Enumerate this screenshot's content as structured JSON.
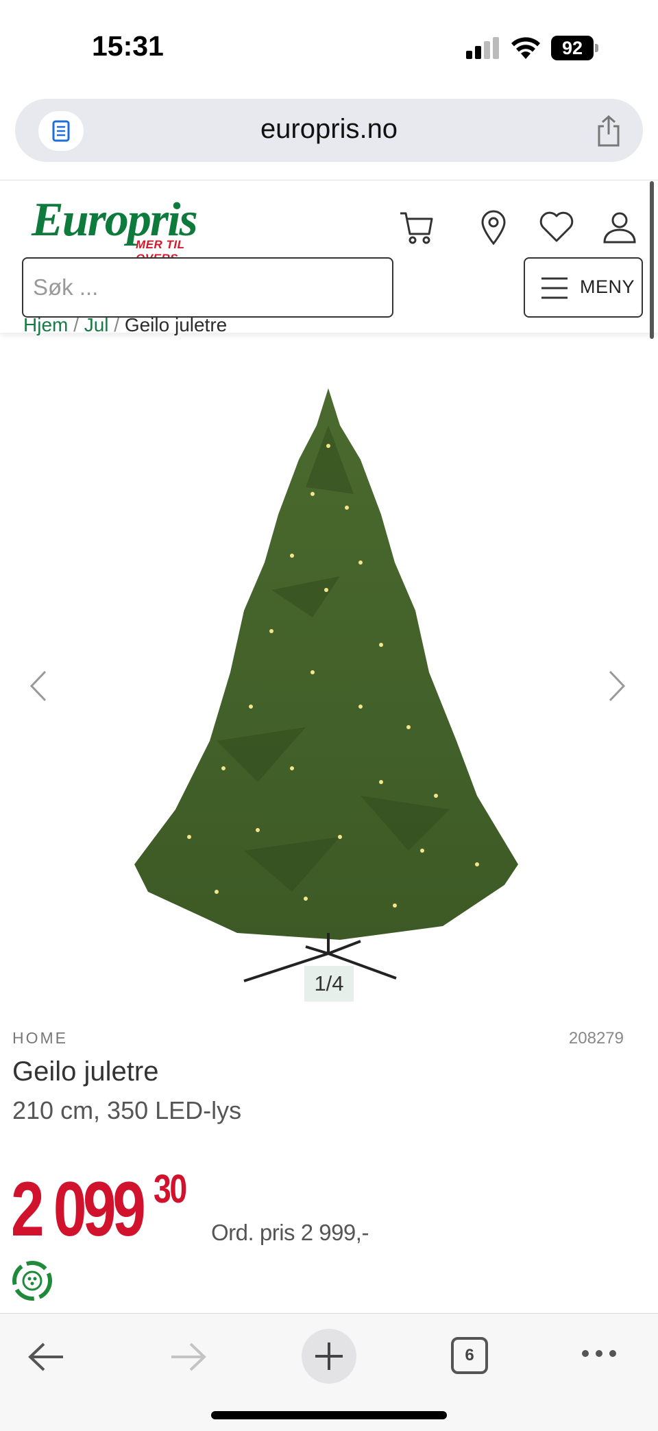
{
  "status_bar": {
    "time": "15:31",
    "battery": "92"
  },
  "browser": {
    "url": "europris.no"
  },
  "header": {
    "logo_text": "Europris",
    "logo_tagline": "MER TIL OVERS",
    "search_placeholder": "Søk ...",
    "menu_label": "MENY"
  },
  "breadcrumb": {
    "items": [
      "Hjem",
      "Jul",
      "Geilo juletre"
    ],
    "separator": "/"
  },
  "gallery": {
    "counter": "1/4"
  },
  "product": {
    "brand": "HOME",
    "sku": "208279",
    "title": "Geilo juletre",
    "subtitle": "210 cm, 350 LED-lys",
    "price_main": "2 099",
    "price_cents": "30",
    "ordinary_price": "Ord. pris 2 999,-"
  },
  "toolbar": {
    "tabs_count": "6"
  },
  "colors": {
    "brand_green": "#0e7a3c",
    "price_red": "#d1122c",
    "tagline_red": "#d6172a"
  }
}
